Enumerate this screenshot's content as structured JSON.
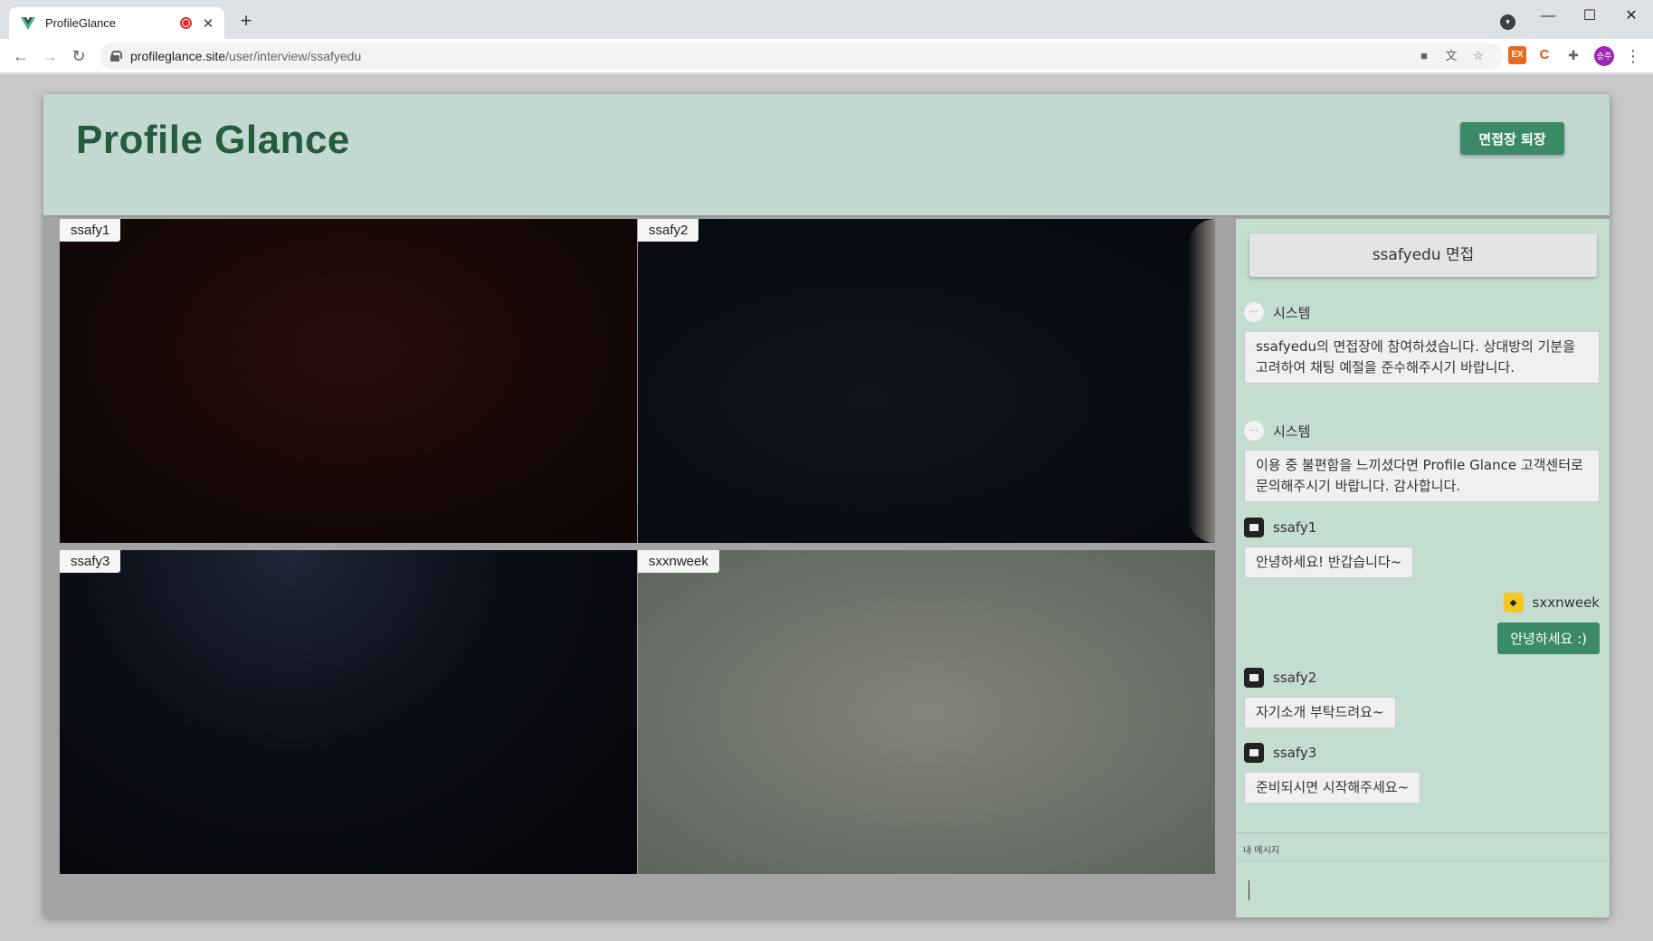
{
  "browser": {
    "tab_title": "ProfileGlance",
    "new_tab_label": "+",
    "close_tab_label": "✕",
    "url_host": "profileglance.site",
    "url_path": "/user/interview/ssafyedu",
    "profile_initials": "승주",
    "window_controls": {
      "minimize": "—",
      "maximize": "☐",
      "close": "✕"
    }
  },
  "app": {
    "logo": "Profile Glance",
    "exit_button": "면접장 퇴장"
  },
  "videos": [
    {
      "label": "ssafy1"
    },
    {
      "label": "ssafy2"
    },
    {
      "label": "ssafy3"
    },
    {
      "label": "sxxnweek"
    }
  ],
  "chat": {
    "title": "ssafyedu 면접",
    "messages": [
      {
        "sender": "시스템",
        "text": "ssafyedu의 면접장에 참여하셨습니다. 상대방의 기분을 고려하여 채팅 예절을 준수해주시기 바랍니다."
      },
      {
        "sender": "시스템",
        "text": "이용 중 불편함을 느끼셨다면 Profile Glance 고객센터로 문의해주시기 바랍니다. 감사합니다."
      },
      {
        "sender": "ssafy1",
        "text": "안녕하세요! 반갑습니다~"
      },
      {
        "sender": "sxxnweek",
        "text": "안녕하세요 :)"
      },
      {
        "sender": "ssafy2",
        "text": "자기소개 부탁드려요~"
      },
      {
        "sender": "ssafy3",
        "text": "준비되시면 시작해주세요~"
      }
    ],
    "input_label": "내 메시지"
  },
  "colors": {
    "accent": "#3a8a67",
    "header_bg": "#c4d8d2",
    "chat_bg": "#c4ddd1",
    "logo": "#245c40"
  }
}
